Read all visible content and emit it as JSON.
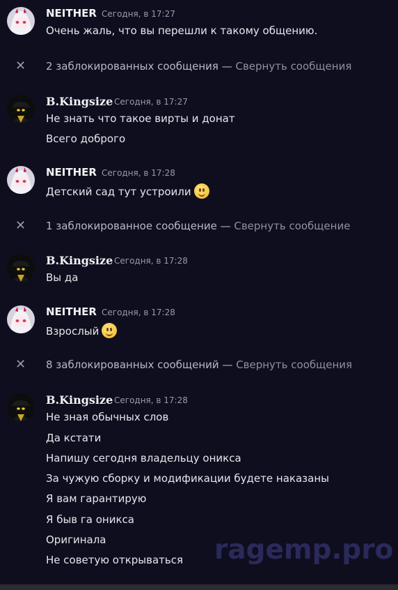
{
  "users": {
    "neither": "NEITHER",
    "kingsize": "B.Kingsize"
  },
  "groups": [
    {
      "time": "Сегодня, в 17:27",
      "messages": [
        "Очень жаль, что вы перешли к такому общению."
      ]
    },
    {
      "time": "Сегодня, в 17:27",
      "messages": [
        "Не знать что такое вирты и донат",
        "Всего доброго"
      ]
    },
    {
      "time": "Сегодня, в 17:28",
      "messages": [
        "Детский сад тут устроили"
      ]
    },
    {
      "time": "Сегодня, в 17:28",
      "messages": [
        "Вы да"
      ]
    },
    {
      "time": "Сегодня, в 17:28",
      "messages": [
        "Взрослый"
      ]
    },
    {
      "time": "Сегодня, в 17:28",
      "messages": [
        "Не зная обычных слов",
        "Да кстати",
        "Напишу сегодня владельцу оникса",
        "За чужую сборку и модификации будете наказаны",
        "Я вам гарантирую",
        "Я быв га оникса",
        "Оригинала",
        "Не советую открываться"
      ]
    }
  ],
  "blocked": [
    {
      "text": "2 заблокированных сообщения — ",
      "link": "Свернуть сообщения"
    },
    {
      "text": "1 заблокированное сообщение — ",
      "link": "Свернуть сообщение"
    },
    {
      "text": "8 заблокированных сообщений — ",
      "link": "Свернуть сообщения"
    }
  ],
  "icons": {
    "close": "close-icon",
    "emoji": "slightly-smiling-face"
  },
  "watermark": "ragemp.pro"
}
